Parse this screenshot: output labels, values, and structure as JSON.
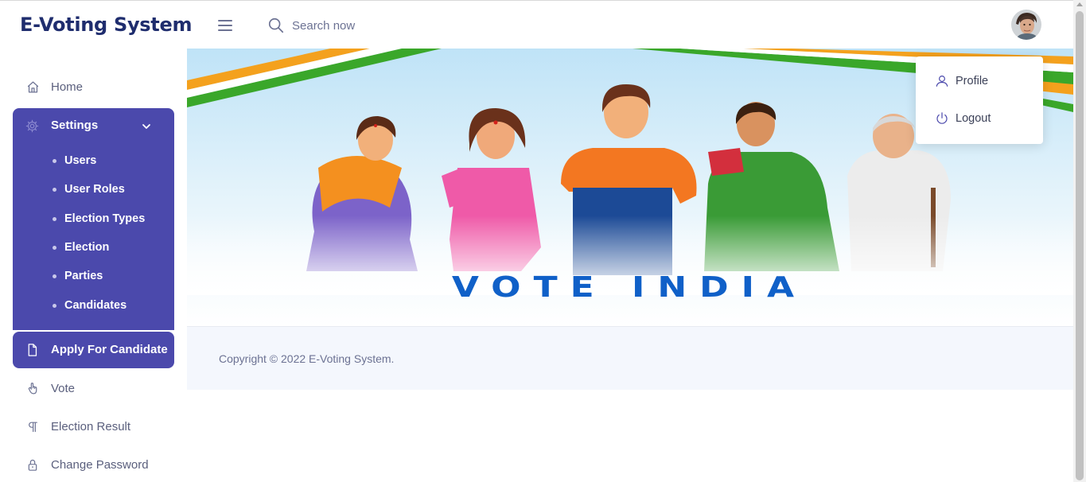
{
  "brand": "E-Voting System",
  "search": {
    "placeholder": "Search now"
  },
  "user_menu": {
    "items": [
      {
        "label": "Profile",
        "icon": "user-icon"
      },
      {
        "label": "Logout",
        "icon": "power-icon"
      }
    ]
  },
  "sidebar": {
    "home": "Home",
    "settings": {
      "label": "Settings",
      "items": [
        "Users",
        "User Roles",
        "Election Types",
        "Election",
        "Parties",
        "Candidates"
      ]
    },
    "apply": "Apply For Candidate",
    "vote": "Vote",
    "result": "Election Result",
    "change_password": "Change Password"
  },
  "banner": {
    "headline": "VOTE INDIA"
  },
  "footer": {
    "copyright": "Copyright © 2022 E-Voting System."
  },
  "colors": {
    "accent": "#4b49ac",
    "brand_text": "#1f2d6e",
    "saffron": "#f4a11d",
    "green": "#3aa72a",
    "vote_blue": "#1060c8"
  }
}
